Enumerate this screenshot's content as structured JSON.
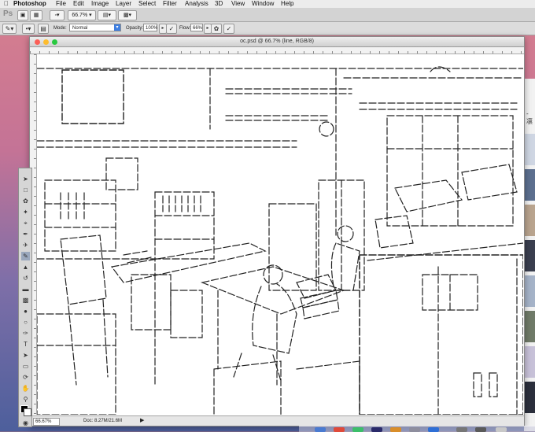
{
  "menubar": {
    "apple": "",
    "app": "Photoshop",
    "items": [
      "File",
      "Edit",
      "Image",
      "Layer",
      "Select",
      "Filter",
      "Analysis",
      "3D",
      "View",
      "Window",
      "Help"
    ]
  },
  "options_bar1": {
    "logo": "Ps",
    "zoom_value": "66.7%"
  },
  "options_bar2": {
    "mode_label": "Mode:",
    "mode_value": "Normal",
    "opacity_label": "Opacity:",
    "opacity_value": "100%",
    "flow_label": "Flow:",
    "flow_value": "66%"
  },
  "document": {
    "title": "oc.psd @ 66.7% (line, RGB/8)",
    "status_zoom": "66.67%",
    "status_doc": "Doc: 8.27M/21.6M"
  },
  "right_strip": {
    "text": "- 凛"
  },
  "colors": {
    "close": "#fc5f57",
    "minimize": "#fdbc2e",
    "zoom": "#29c940",
    "accent": "#3f7fe0"
  },
  "icons": [
    "apple-icon",
    "brush-preset-icon",
    "screen-mode-icon",
    "arrange-icon",
    "airbrush-icon",
    "tablet-pressure-icon"
  ]
}
